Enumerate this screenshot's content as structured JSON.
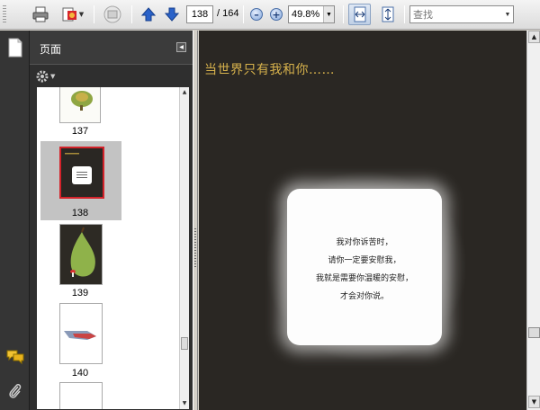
{
  "toolbar": {
    "current_page": "138",
    "total_pages": "/ 164",
    "zoom": "49.8%",
    "search_placeholder": "查找",
    "colors": {
      "arrow_blue": "#2a62c9",
      "active_bg": "#c0d0e6"
    }
  },
  "pages_panel": {
    "title": "页面",
    "thumbnails": [
      {
        "label": "137"
      },
      {
        "label": "138",
        "selected": true
      },
      {
        "label": "139"
      },
      {
        "label": "140"
      }
    ]
  },
  "document": {
    "heading": "当世界只有我和你……",
    "poem_lines": [
      "我对你诉苦时，",
      "请你一定要安慰我，",
      "我就是需要你温暖的安慰，",
      "才会对你说。"
    ],
    "heading_color": "#d7b24c",
    "background_color": "#2a2723"
  },
  "icons": {
    "print": "printer-icon",
    "create": "create-pdf-icon",
    "collab": "collaborate-icon",
    "prev": "previous-page-icon",
    "next": "next-page-icon",
    "zoom_out": "zoom-out-icon",
    "zoom_in": "zoom-in-icon",
    "fit_width": "fit-width-icon",
    "fit_page": "fit-page-icon",
    "pages": "pages-panel-icon",
    "comments": "comments-icon",
    "attachments": "attachments-icon",
    "options": "gear-icon"
  }
}
